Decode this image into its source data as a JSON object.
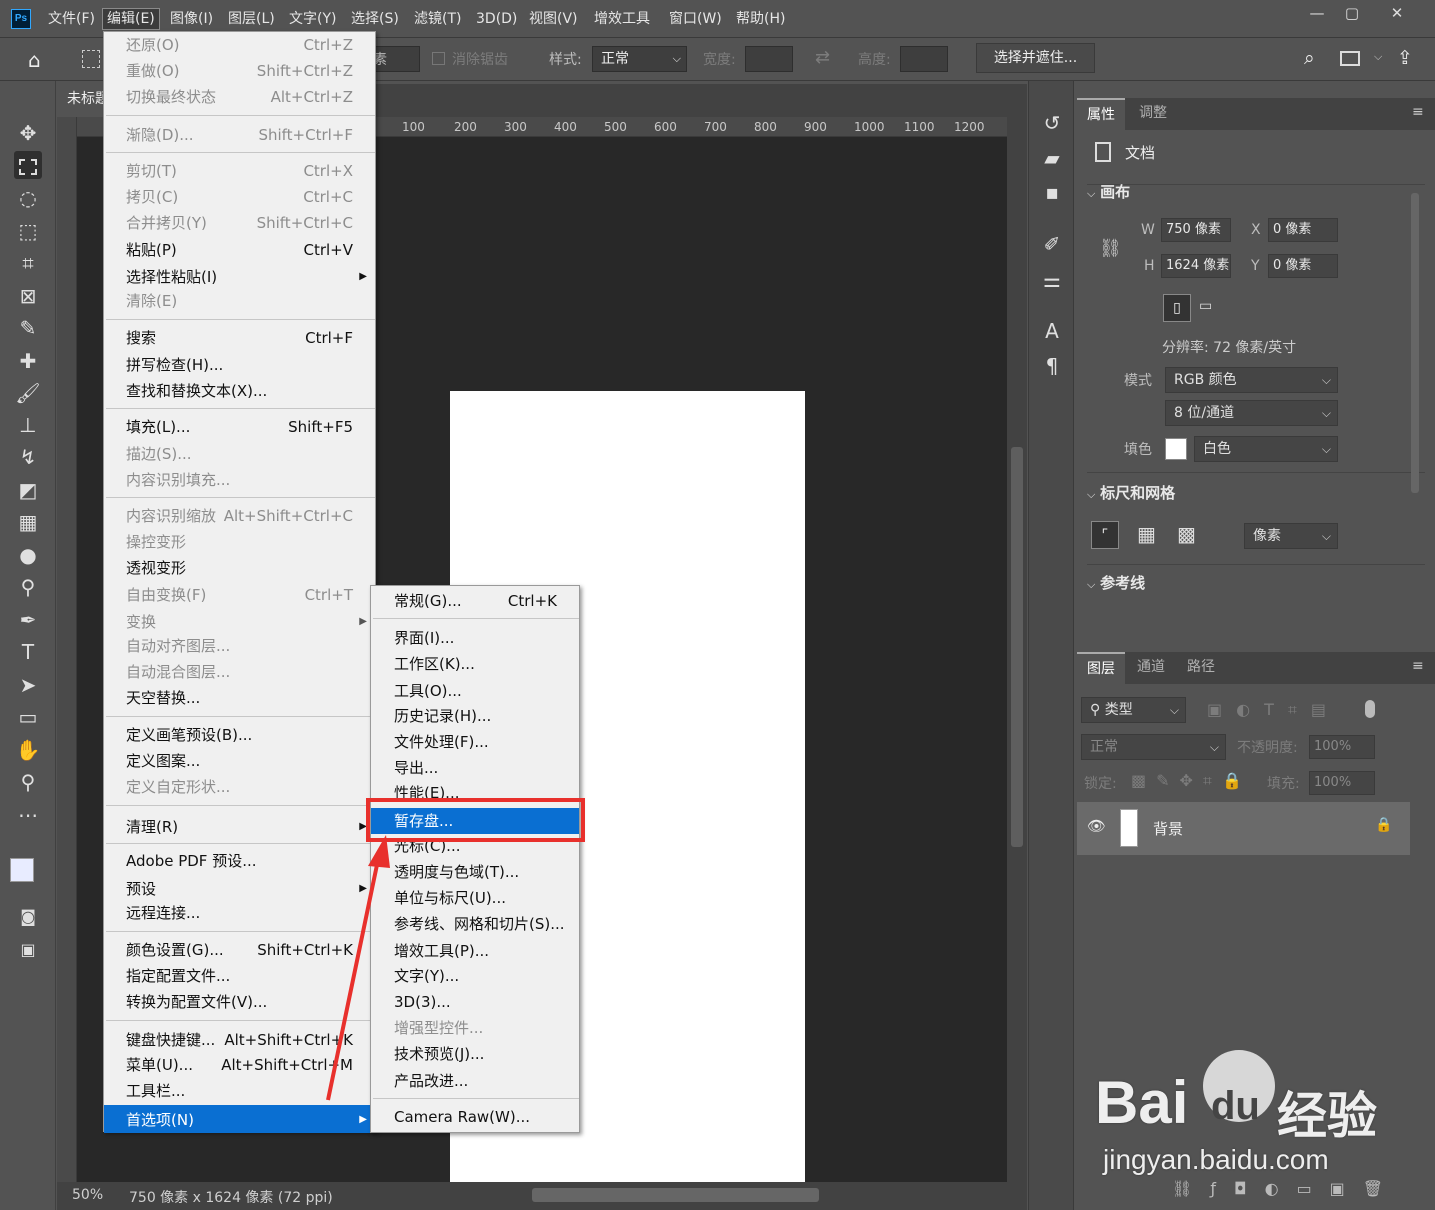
{
  "app": {
    "logo": "Ps"
  },
  "menubar": {
    "items": [
      "文件(F)",
      "编辑(E)",
      "图像(I)",
      "图层(L)",
      "文字(Y)",
      "选择(S)",
      "滤镜(T)",
      "3D(D)",
      "视图(V)",
      "增效工具",
      "窗口(W)",
      "帮助(H)"
    ],
    "window": [
      "—",
      "▢",
      "✕"
    ]
  },
  "options": {
    "feather_suffix": "素",
    "antialias": "消除锯齿",
    "style_label": "样式:",
    "style_value": "正常",
    "width_label": "宽度:",
    "height_label": "高度:",
    "select_mask": "选择并遮住..."
  },
  "document": {
    "tab_title": "未标题",
    "zoom": "50%",
    "info": "750 像素 x 1624 像素 (72 ppi)"
  },
  "ruler": {
    "ticks": [
      "100",
      "200",
      "300",
      "400",
      "500",
      "600",
      "700",
      "800",
      "900",
      "1000",
      "1100",
      "1200"
    ]
  },
  "edit_menu": {
    "items": [
      {
        "label": "还原(O)",
        "shortcut": "Ctrl+Z",
        "disabled": true
      },
      {
        "label": "重做(O)",
        "shortcut": "Shift+Ctrl+Z",
        "disabled": true
      },
      {
        "label": "切换最终状态",
        "shortcut": "Alt+Ctrl+Z",
        "disabled": true
      },
      {
        "label": "渐隐(D)...",
        "shortcut": "Shift+Ctrl+F",
        "disabled": true
      },
      {
        "label": "剪切(T)",
        "shortcut": "Ctrl+X",
        "disabled": true
      },
      {
        "label": "拷贝(C)",
        "shortcut": "Ctrl+C",
        "disabled": true
      },
      {
        "label": "合并拷贝(Y)",
        "shortcut": "Shift+Ctrl+C",
        "disabled": true
      },
      {
        "label": "粘贴(P)",
        "shortcut": "Ctrl+V",
        "disabled": false
      },
      {
        "label": "选择性粘贴(I)",
        "shortcut": "",
        "disabled": false
      },
      {
        "label": "清除(E)",
        "shortcut": "",
        "disabled": true
      },
      {
        "label": "搜索",
        "shortcut": "Ctrl+F",
        "disabled": false
      },
      {
        "label": "拼写检查(H)...",
        "shortcut": "",
        "disabled": false
      },
      {
        "label": "查找和替换文本(X)...",
        "shortcut": "",
        "disabled": false
      },
      {
        "label": "填充(L)...",
        "shortcut": "Shift+F5",
        "disabled": false
      },
      {
        "label": "描边(S)...",
        "shortcut": "",
        "disabled": true
      },
      {
        "label": "内容识别填充...",
        "shortcut": "",
        "disabled": true
      },
      {
        "label": "内容识别缩放",
        "shortcut": "Alt+Shift+Ctrl+C",
        "disabled": true
      },
      {
        "label": "操控变形",
        "shortcut": "",
        "disabled": true
      },
      {
        "label": "透视变形",
        "shortcut": "",
        "disabled": false
      },
      {
        "label": "自由变换(F)",
        "shortcut": "Ctrl+T",
        "disabled": true
      },
      {
        "label": "变换",
        "shortcut": "",
        "disabled": true
      },
      {
        "label": "自动对齐图层...",
        "shortcut": "",
        "disabled": true
      },
      {
        "label": "自动混合图层...",
        "shortcut": "",
        "disabled": true
      },
      {
        "label": "天空替换...",
        "shortcut": "",
        "disabled": false
      },
      {
        "label": "定义画笔预设(B)...",
        "shortcut": "",
        "disabled": false
      },
      {
        "label": "定义图案...",
        "shortcut": "",
        "disabled": false
      },
      {
        "label": "定义自定形状...",
        "shortcut": "",
        "disabled": true
      },
      {
        "label": "清理(R)",
        "shortcut": "",
        "disabled": false
      },
      {
        "label": "Adobe PDF 预设...",
        "shortcut": "",
        "disabled": false
      },
      {
        "label": "预设",
        "shortcut": "",
        "disabled": false
      },
      {
        "label": "远程连接...",
        "shortcut": "",
        "disabled": false
      },
      {
        "label": "颜色设置(G)...",
        "shortcut": "Shift+Ctrl+K",
        "disabled": false
      },
      {
        "label": "指定配置文件...",
        "shortcut": "",
        "disabled": false
      },
      {
        "label": "转换为配置文件(V)...",
        "shortcut": "",
        "disabled": false
      },
      {
        "label": "键盘快捷键...",
        "shortcut": "Alt+Shift+Ctrl+K",
        "disabled": false
      },
      {
        "label": "菜单(U)...",
        "shortcut": "Alt+Shift+Ctrl+M",
        "disabled": false
      },
      {
        "label": "工具栏...",
        "shortcut": "",
        "disabled": false
      },
      {
        "label": "首选项(N)",
        "shortcut": "",
        "disabled": false
      }
    ]
  },
  "pref_menu": {
    "items": [
      {
        "label": "常规(G)...",
        "shortcut": "Ctrl+K",
        "disabled": false
      },
      {
        "label": "界面(I)...",
        "shortcut": "",
        "disabled": false
      },
      {
        "label": "工作区(K)...",
        "shortcut": "",
        "disabled": false
      },
      {
        "label": "工具(O)...",
        "shortcut": "",
        "disabled": false
      },
      {
        "label": "历史记录(H)...",
        "shortcut": "",
        "disabled": false
      },
      {
        "label": "文件处理(F)...",
        "shortcut": "",
        "disabled": false
      },
      {
        "label": "导出...",
        "shortcut": "",
        "disabled": false
      },
      {
        "label": "性能(E)...",
        "shortcut": "",
        "disabled": false
      },
      {
        "label": "暂存盘...",
        "shortcut": "",
        "disabled": false
      },
      {
        "label": "光标(C)...",
        "shortcut": "",
        "disabled": false
      },
      {
        "label": "透明度与色域(T)...",
        "shortcut": "",
        "disabled": false
      },
      {
        "label": "单位与标尺(U)...",
        "shortcut": "",
        "disabled": false
      },
      {
        "label": "参考线、网格和切片(S)...",
        "shortcut": "",
        "disabled": false
      },
      {
        "label": "增效工具(P)...",
        "shortcut": "",
        "disabled": false
      },
      {
        "label": "文字(Y)...",
        "shortcut": "",
        "disabled": false
      },
      {
        "label": "3D(3)...",
        "shortcut": "",
        "disabled": false
      },
      {
        "label": "增强型控件...",
        "shortcut": "",
        "disabled": true
      },
      {
        "label": "技术预览(J)...",
        "shortcut": "",
        "disabled": false
      },
      {
        "label": "产品改进...",
        "shortcut": "",
        "disabled": false
      },
      {
        "label": "Camera Raw(W)...",
        "shortcut": "",
        "disabled": false
      }
    ]
  },
  "properties": {
    "tab1": "属性",
    "tab2": "调整",
    "doc": "文档",
    "canvas": "画布",
    "w_label": "W",
    "w_value": "750 像素",
    "h_label": "H",
    "h_value": "1624 像素",
    "x_label": "X",
    "x_value": "0 像素",
    "y_label": "Y",
    "y_value": "0 像素",
    "resolution": "分辨率: 72 像素/英寸",
    "mode_label": "模式",
    "mode_value": "RGB 颜色",
    "bits_value": "8 位/通道",
    "fill_label": "填色",
    "fill_value": "白色",
    "rulers_grid": "标尺和网格",
    "unit_value": "像素",
    "guides": "参考线"
  },
  "layers": {
    "tabs": [
      "图层",
      "通道",
      "路径"
    ],
    "kind": "类型",
    "blend": "正常",
    "opacity_label": "不透明度:",
    "opacity_value": "100%",
    "lock_label": "锁定:",
    "fill_label": "填充:",
    "fill_value": "100%",
    "layer_name": "背景"
  },
  "watermark": {
    "brand": "Bai",
    "brand2": "du",
    "suffix": "经验",
    "url": "jingyan.baidu.com"
  },
  "colors": {
    "highlight": "#e8302c",
    "menu_select": "#0a6fd2"
  }
}
